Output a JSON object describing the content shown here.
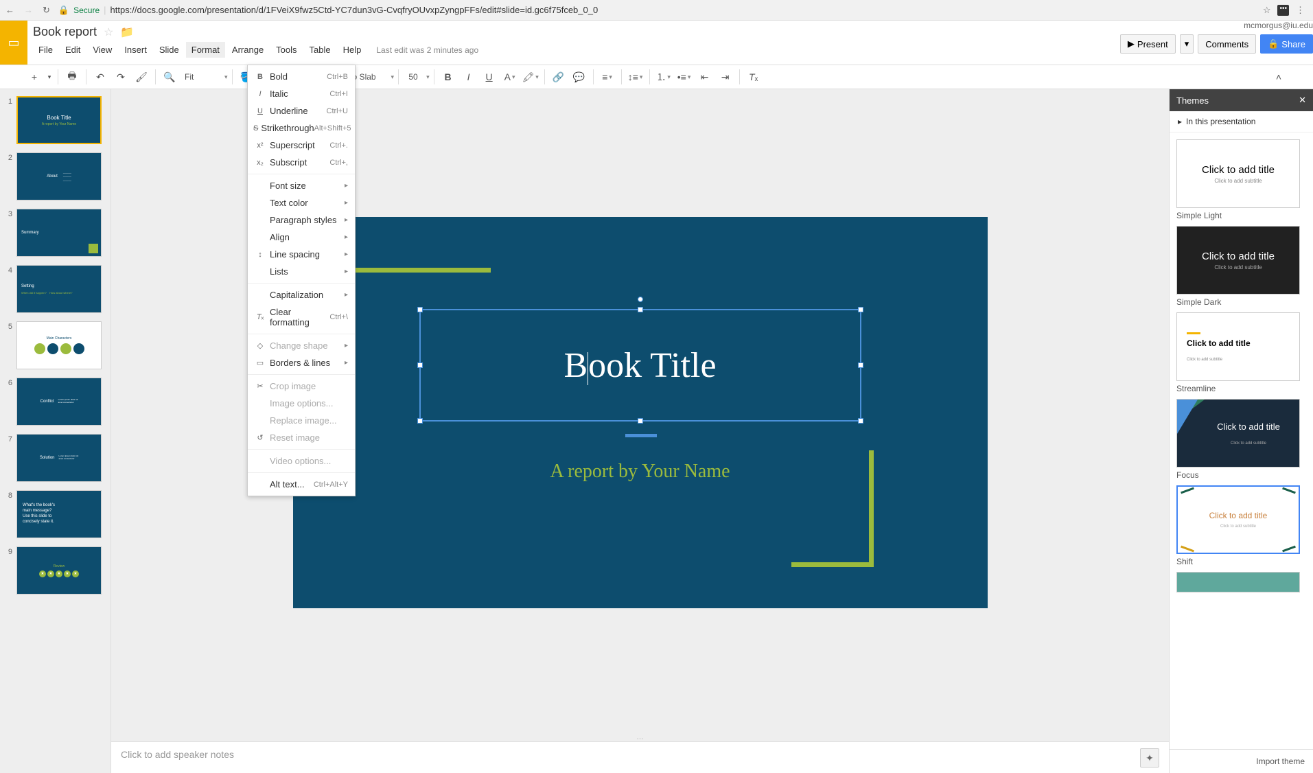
{
  "browser": {
    "secure_label": "Secure",
    "url": "https://docs.google.com/presentation/d/1FVeiX9fwz5Ctd-YC7dun3vG-CvqfryOUvxpZyngpFFs/edit#slide=id.gc6f75fceb_0_0"
  },
  "header": {
    "doc_title": "Book report",
    "user_email": "mcmorgus@iu.edu",
    "present": "Present",
    "comments": "Comments",
    "share": "Share",
    "last_edit": "Last edit was 2 minutes ago"
  },
  "menus": [
    "File",
    "Edit",
    "View",
    "Insert",
    "Slide",
    "Format",
    "Arrange",
    "Tools",
    "Table",
    "Help"
  ],
  "toolbar": {
    "zoom": "Fit",
    "font": "Roboto Slab",
    "font_size": "50"
  },
  "format_menu": {
    "bold": {
      "label": "Bold",
      "shortcut": "Ctrl+B",
      "icon": "B"
    },
    "italic": {
      "label": "Italic",
      "shortcut": "Ctrl+I",
      "icon": "I"
    },
    "underline": {
      "label": "Underline",
      "shortcut": "Ctrl+U",
      "icon": "U"
    },
    "strike": {
      "label": "Strikethrough",
      "shortcut": "Alt+Shift+5",
      "icon": "S"
    },
    "superscript": {
      "label": "Superscript",
      "shortcut": "Ctrl+.",
      "icon": "x²"
    },
    "subscript": {
      "label": "Subscript",
      "shortcut": "Ctrl+,",
      "icon": "x₂"
    },
    "font_size": "Font size",
    "text_color": "Text color",
    "paragraph": "Paragraph styles",
    "align": "Align",
    "line_spacing": "Line spacing",
    "lists": "Lists",
    "capitalization": "Capitalization",
    "clear": {
      "label": "Clear formatting",
      "shortcut": "Ctrl+\\"
    },
    "change_shape": "Change shape",
    "borders": "Borders & lines",
    "crop": "Crop image",
    "image_opts": "Image options...",
    "replace_img": "Replace image...",
    "reset_img": "Reset image",
    "video_opts": "Video options...",
    "alt_text": {
      "label": "Alt text...",
      "shortcut": "Ctrl+Alt+Y"
    }
  },
  "slide": {
    "title": "Book Title",
    "subtitle": "A report by Your Name"
  },
  "filmstrip_count": 9,
  "notes_placeholder": "Click to add speaker notes",
  "themes": {
    "header": "Themes",
    "section": "In this presentation",
    "import": "Import theme",
    "items": [
      {
        "name": "Simple Light",
        "title": "Click to add title",
        "sub": "Click to add subtitle"
      },
      {
        "name": "Simple Dark",
        "title": "Click to add title",
        "sub": "Click to add subtitle"
      },
      {
        "name": "Streamline",
        "title": "Click to add title",
        "sub": "Click to add subtitle"
      },
      {
        "name": "Focus",
        "title": "Click to add title",
        "sub": "Click to add subtitle"
      },
      {
        "name": "Shift",
        "title": "Click to add title",
        "sub": "Click to add subtitle"
      }
    ]
  }
}
